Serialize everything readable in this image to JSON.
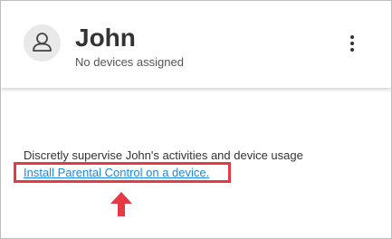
{
  "profile": {
    "name": "John",
    "status": "No devices assigned",
    "avatar_icon": "user-avatar-icon",
    "menu_icon": "more-vertical-icon"
  },
  "content": {
    "description": "Discretly supervise John's activities and device usage",
    "install_link": "Install Parental Control on a device."
  },
  "colors": {
    "link": "#1e88e5",
    "highlight": "#e53945",
    "avatar_bg": "#e9e9e9",
    "text": "#333333"
  }
}
